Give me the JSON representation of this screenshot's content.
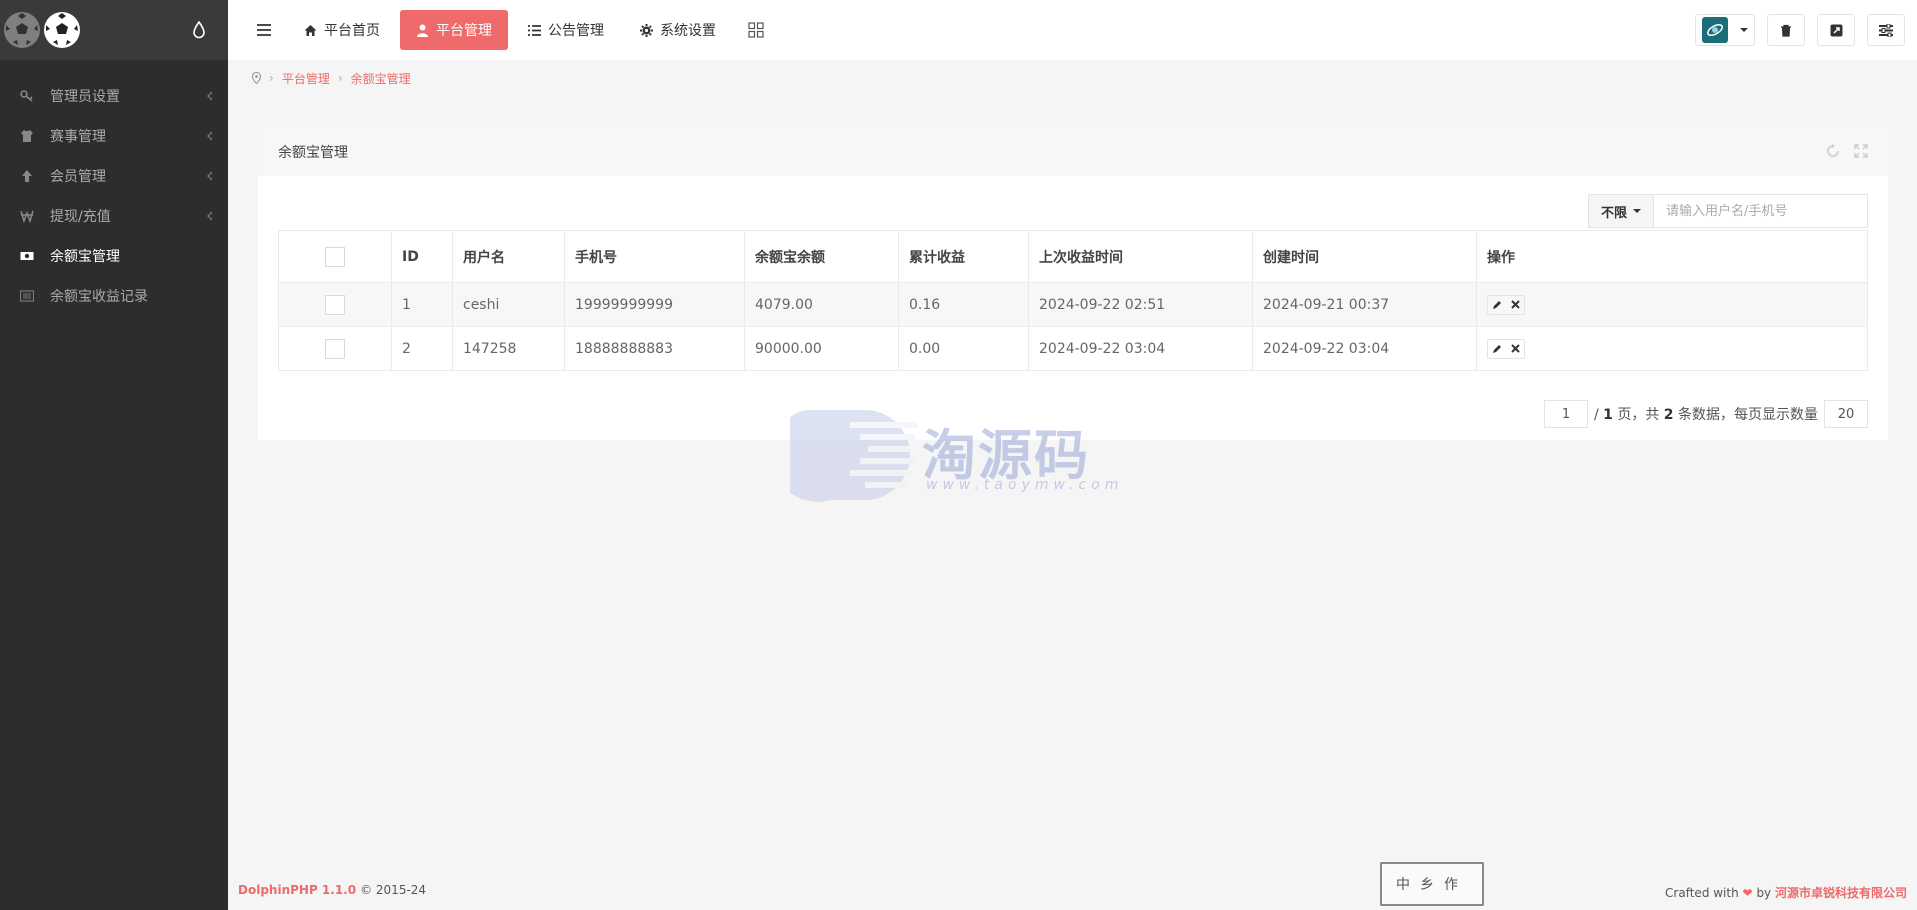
{
  "sidebar": {
    "items": [
      {
        "label": "管理员设置",
        "icon": "key-icon",
        "has_children": true
      },
      {
        "label": "赛事管理",
        "icon": "shirt-icon",
        "has_children": true
      },
      {
        "label": "会员管理",
        "icon": "arrow-up-icon",
        "has_children": true
      },
      {
        "label": "提现/充值",
        "icon": "won-icon",
        "has_children": true
      },
      {
        "label": "余额宝管理",
        "icon": "money-icon",
        "has_children": false,
        "active": true
      },
      {
        "label": "余额宝收益记录",
        "icon": "list-icon",
        "has_children": false
      }
    ]
  },
  "topbar": {
    "tabs": [
      {
        "label": "平台首页",
        "icon": "home-icon"
      },
      {
        "label": "平台管理",
        "icon": "user-icon",
        "active": true
      },
      {
        "label": "公告管理",
        "icon": "list-icon"
      },
      {
        "label": "系统设置",
        "icon": "gear-icon"
      }
    ]
  },
  "breadcrumb": {
    "items": [
      "平台管理",
      "余额宝管理"
    ]
  },
  "panel": {
    "title": "余额宝管理",
    "filter_label": "不限",
    "search_placeholder": "请输入用户名/手机号"
  },
  "table": {
    "headers": [
      "ID",
      "用户名",
      "手机号",
      "余额宝余额",
      "累计收益",
      "上次收益时间",
      "创建时间",
      "操作"
    ],
    "rows": [
      {
        "id": "1",
        "username": "ceshi",
        "phone": "19999999999",
        "balance": "4079.00",
        "total": "0.16",
        "last_time": "2024-09-22 02:51",
        "created": "2024-09-21 00:37"
      },
      {
        "id": "2",
        "username": "147258",
        "phone": "18888888883",
        "balance": "90000.00",
        "total": "0.00",
        "last_time": "2024-09-22 03:04",
        "created": "2024-09-22 03:04"
      }
    ]
  },
  "pager": {
    "current": "1",
    "text_before": "/",
    "total_pages": "1",
    "text_mid1": "页，共",
    "total_items": "2",
    "text_mid2": "条数据，每页显示数量",
    "per_page": "20"
  },
  "watermark": {
    "text": "淘源码",
    "url": "www.taoymw.com"
  },
  "footer": {
    "brand": "DolphinPHP 1.1.0",
    "copyright": "© 2015-24",
    "crafted": "Crafted with",
    "by": "by",
    "company": "河源市卓锐科技有限公司",
    "stamp_text": "中乡作"
  },
  "colors": {
    "accent": "#ef6a6a",
    "sidebar_bg": "#2d2d2d",
    "logo_bar_bg": "#3a3a3a"
  }
}
